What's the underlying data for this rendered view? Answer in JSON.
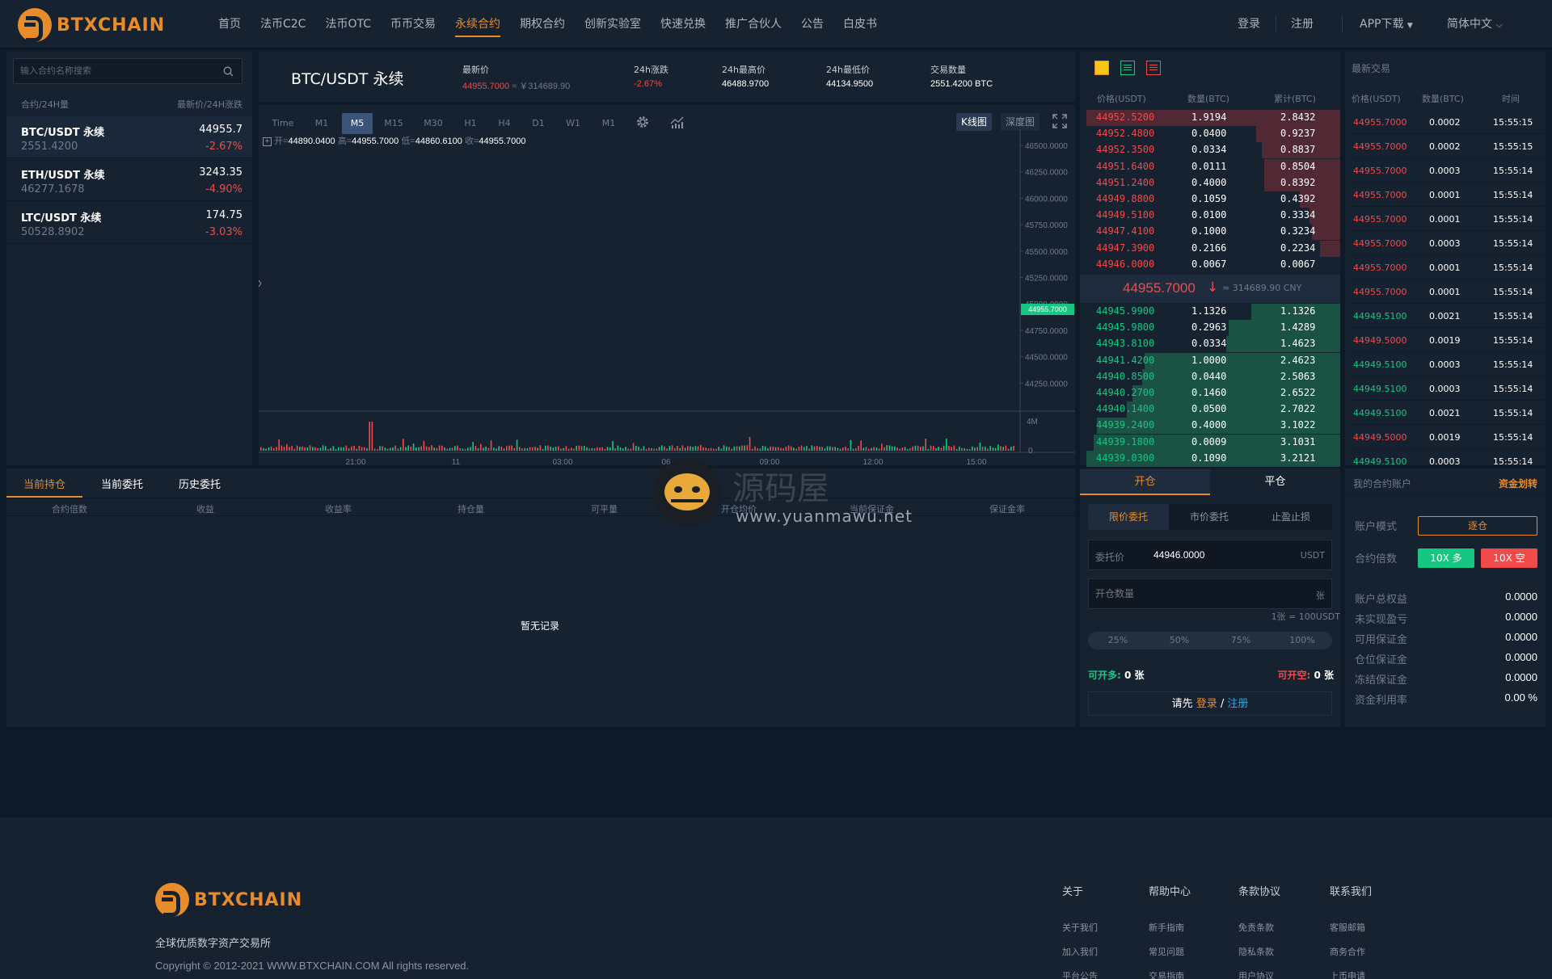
{
  "brand": {
    "name": "BTXCHAIN",
    "tagline": "全球优质数字资产交易所"
  },
  "nav": {
    "items": [
      "首页",
      "法币C2C",
      "法币OTC",
      "币币交易",
      "永续合约",
      "期权合约",
      "创新实验室",
      "快速兑换",
      "推广合伙人",
      "公告",
      "白皮书"
    ],
    "login": "登录",
    "register": "注册",
    "app": "APP下载",
    "lang": "简体中文"
  },
  "markets": {
    "search_placeholder": "输入合约名称搜索",
    "head_left": "合约/24H量",
    "head_right": "最新价/24H涨跌",
    "rows": [
      {
        "name": "BTC/USDT 永续",
        "vol": "2551.4200",
        "price": "44955.7",
        "change": "-2.67%"
      },
      {
        "name": "ETH/USDT 永续",
        "vol": "46277.1678",
        "price": "3243.35",
        "change": "-4.90%"
      },
      {
        "name": "LTC/USDT 永续",
        "vol": "50528.8902",
        "price": "174.75",
        "change": "-3.03%"
      }
    ]
  },
  "ticker": {
    "symbol": "BTC/USDT 永续",
    "last_label": "最新价",
    "last": "44955.7000",
    "last_cny": "≈ ￥314689.90",
    "chg_label": "24h涨跌",
    "chg": "-2.67%",
    "high_label": "24h最高价",
    "high": "46488.9700",
    "low_label": "24h最低价",
    "low": "44134.9500",
    "vol_label": "交易数量",
    "vol": "2551.4200 BTC"
  },
  "chart": {
    "timeframes": [
      "Time",
      "M1",
      "M5",
      "M15",
      "M30",
      "H1",
      "H4",
      "D1",
      "W1",
      "M1"
    ],
    "active_tf": "M5",
    "views": [
      "K线图",
      "深度图"
    ],
    "ohlc": {
      "open_label": "开=",
      "open": "44890.0400",
      "high_label": "高=",
      "high": "44955.7000",
      "low_label": "低=",
      "low": "44860.6100",
      "close_label": "收=",
      "close": "44955.7000"
    },
    "y_ticks": [
      "46500.0000",
      "46250.0000",
      "46000.0000",
      "45750.0000",
      "45500.0000",
      "45250.0000",
      "45000.0000",
      "44750.0000",
      "44500.0000",
      "44250.0000"
    ],
    "price_tag": "44955.7000",
    "vol_ticks": [
      "4M",
      "0"
    ],
    "x_ticks": [
      "21:00",
      "11",
      "03:00",
      "06",
      "09:00",
      "12:00",
      "15:00"
    ]
  },
  "orderbook": {
    "head": [
      "价格(USDT)",
      "数量(BTC)",
      "累计(BTC)"
    ],
    "asks": [
      {
        "p": "44952.5200",
        "q": "1.9194",
        "t": "2.8432",
        "d": 1.0
      },
      {
        "p": "44952.4800",
        "q": "0.0400",
        "t": "0.9237",
        "d": 0.33
      },
      {
        "p": "44952.3500",
        "q": "0.0334",
        "t": "0.8837",
        "d": 0.31
      },
      {
        "p": "44951.6400",
        "q": "0.0111",
        "t": "0.8504",
        "d": 0.3
      },
      {
        "p": "44951.2400",
        "q": "0.4000",
        "t": "0.8392",
        "d": 0.3
      },
      {
        "p": "44949.8800",
        "q": "0.1059",
        "t": "0.4392",
        "d": 0.16
      },
      {
        "p": "44949.5100",
        "q": "0.0100",
        "t": "0.3334",
        "d": 0.12
      },
      {
        "p": "44947.4100",
        "q": "0.1000",
        "t": "0.3234",
        "d": 0.11
      },
      {
        "p": "44947.3900",
        "q": "0.2166",
        "t": "0.2234",
        "d": 0.08
      },
      {
        "p": "44946.0000",
        "q": "0.0067",
        "t": "0.0067",
        "d": 0.0
      }
    ],
    "mid_price": "44955.7000",
    "mid_arrow": "↓",
    "mid_cny": "≈ 314689.90 CNY",
    "bids": [
      {
        "p": "44945.9900",
        "q": "1.1326",
        "t": "1.1326",
        "d": 0.35
      },
      {
        "p": "44945.9800",
        "q": "0.2963",
        "t": "1.4289",
        "d": 0.44
      },
      {
        "p": "44943.8100",
        "q": "0.0334",
        "t": "1.4623",
        "d": 0.45
      },
      {
        "p": "44941.4200",
        "q": "1.0000",
        "t": "2.4623",
        "d": 0.77
      },
      {
        "p": "44940.8500",
        "q": "0.0440",
        "t": "2.5063",
        "d": 0.78
      },
      {
        "p": "44940.2700",
        "q": "0.1460",
        "t": "2.6522",
        "d": 0.82
      },
      {
        "p": "44940.1400",
        "q": "0.0500",
        "t": "2.7022",
        "d": 0.84
      },
      {
        "p": "44939.2400",
        "q": "0.4000",
        "t": "3.1022",
        "d": 0.96
      },
      {
        "p": "44939.1800",
        "q": "0.0009",
        "t": "3.1031",
        "d": 0.97
      },
      {
        "p": "44939.0300",
        "q": "0.1090",
        "t": "3.2121",
        "d": 1.0
      }
    ]
  },
  "trades": {
    "title": "最新交易",
    "head": [
      "价格(USDT)",
      "数量(BTC)",
      "时间"
    ],
    "rows": [
      {
        "p": "44955.7000",
        "q": "0.0002",
        "t": "15:55:15",
        "side": "sell"
      },
      {
        "p": "44955.7000",
        "q": "0.0002",
        "t": "15:55:15",
        "side": "sell"
      },
      {
        "p": "44955.7000",
        "q": "0.0003",
        "t": "15:55:14",
        "side": "sell"
      },
      {
        "p": "44955.7000",
        "q": "0.0001",
        "t": "15:55:14",
        "side": "sell"
      },
      {
        "p": "44955.7000",
        "q": "0.0001",
        "t": "15:55:14",
        "side": "sell"
      },
      {
        "p": "44955.7000",
        "q": "0.0003",
        "t": "15:55:14",
        "side": "sell"
      },
      {
        "p": "44955.7000",
        "q": "0.0001",
        "t": "15:55:14",
        "side": "sell"
      },
      {
        "p": "44955.7000",
        "q": "0.0001",
        "t": "15:55:14",
        "side": "sell"
      },
      {
        "p": "44949.5100",
        "q": "0.0021",
        "t": "15:55:14",
        "side": "buy"
      },
      {
        "p": "44949.5000",
        "q": "0.0019",
        "t": "15:55:14",
        "side": "sell"
      },
      {
        "p": "44949.5100",
        "q": "0.0003",
        "t": "15:55:14",
        "side": "buy"
      },
      {
        "p": "44949.5100",
        "q": "0.0003",
        "t": "15:55:14",
        "side": "buy"
      },
      {
        "p": "44949.5100",
        "q": "0.0021",
        "t": "15:55:14",
        "side": "buy"
      },
      {
        "p": "44949.5000",
        "q": "0.0019",
        "t": "15:55:14",
        "side": "sell"
      },
      {
        "p": "44949.5100",
        "q": "0.0003",
        "t": "15:55:14",
        "side": "buy"
      }
    ]
  },
  "positions": {
    "tabs": [
      "当前持仓",
      "当前委托",
      "历史委托"
    ],
    "cols": [
      "合约倍数",
      "收益",
      "收益率",
      "持仓量",
      "可平量",
      "开仓均价",
      "当前保证金",
      "保证金率"
    ],
    "empty": "暂无记录"
  },
  "order": {
    "tabs": [
      "开仓",
      "平仓"
    ],
    "types": [
      "限价委托",
      "市价委托",
      "止盈止损"
    ],
    "price_label": "委托价",
    "price_value": "44946.0000",
    "price_unit": "USDT",
    "qty_placeholder": "开仓数量",
    "qty_unit": "张",
    "contract_note": "1张 = 100USDT",
    "pcts": [
      "25%",
      "50%",
      "75%",
      "100%"
    ],
    "long_label": "可开多:",
    "long_val": "0 张",
    "short_label": "可开空:",
    "short_val": "0 张",
    "login_prefix": "请先",
    "login": "登录",
    "slash": "/",
    "register": "注册"
  },
  "account": {
    "title": "我的合约账户",
    "transfer": "资金划转",
    "mode_label": "账户模式",
    "mode_value": "逐仓",
    "lev_label": "合约倍数",
    "lev_long": "10X 多",
    "lev_short": "10X 空",
    "stats": [
      {
        "label": "账户总权益",
        "value": "0.0000"
      },
      {
        "label": "未实现盈亏",
        "value": "0.0000"
      },
      {
        "label": "可用保证金",
        "value": "0.0000"
      },
      {
        "label": "仓位保证金",
        "value": "0.0000"
      },
      {
        "label": "冻结保证金",
        "value": "0.0000"
      },
      {
        "label": "资金利用率",
        "value": "0.00 %"
      }
    ]
  },
  "watermark": {
    "cn": "源码屋",
    "url": "www.yuanmawu.net"
  },
  "footer": {
    "copyright": "Copyright © 2012-2021 WWW.BTXCHAIN.COM All rights reserved.",
    "cols": [
      {
        "title": "关于",
        "links": [
          "关于我们",
          "加入我们",
          "平台公告"
        ]
      },
      {
        "title": "帮助中心",
        "links": [
          "新手指南",
          "常见问题",
          "交易指南"
        ]
      },
      {
        "title": "条款协议",
        "links": [
          "免责条款",
          "隐私条款",
          "用户协议"
        ]
      },
      {
        "title": "联系我们",
        "links": [
          "客服邮箱",
          "商务合作",
          "上币申请"
        ]
      }
    ]
  },
  "colors": {
    "accent": "#e88b2a",
    "up": "#16c784",
    "down": "#f24a4a",
    "panel": "#172230",
    "bg": "#0f1a28"
  }
}
